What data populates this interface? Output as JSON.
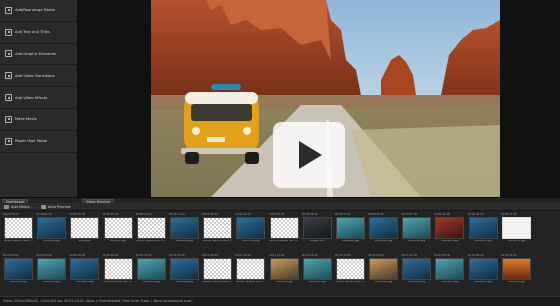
{
  "sidebar": {
    "items": [
      {
        "label": "Add/Rearrange Media",
        "icon": "media-icon"
      },
      {
        "label": "Add Text and Titles",
        "icon": "text-icon"
      },
      {
        "label": "Add Graphic Elements",
        "icon": "graphic-icon"
      },
      {
        "label": "Add Video Transitions",
        "icon": "transition-icon"
      },
      {
        "label": "Add Video Effects",
        "icon": "effects-icon"
      },
      {
        "label": "Make Movie",
        "icon": "movie-icon"
      },
      {
        "label": "Power User Mode",
        "icon": "power-user-icon"
      }
    ]
  },
  "tabs": {
    "left": "Dashboard",
    "right": "Video Preview"
  },
  "media_toolbar": {
    "add_media": "Add Media...",
    "auto_preview": "Auto Preview"
  },
  "gallery": {
    "rows": [
      [
        {
          "ts": "00:00:00.00",
          "name": "M0456 Yellow & Text Ti...",
          "kind": "text"
        },
        {
          "ts": "00:00:01.00",
          "name": "DSC09015.jpg",
          "kind": "blue"
        },
        {
          "ts": "00:00:05.00",
          "name": "unlog.text",
          "kind": "transparent"
        },
        {
          "ts": "00:00:07.00",
          "name": "launch01.jpg",
          "kind": "transparent"
        },
        {
          "ts": "00:00:10.00",
          "name": "M0456 Yellow & Text Ti...",
          "kind": "text"
        },
        {
          "ts": "00:00:14.00",
          "name": "DSC09024.jpg",
          "kind": "blue"
        },
        {
          "ts": "00:00:18.00",
          "name": "M0456 Yellow & Text Ti...",
          "kind": "text"
        },
        {
          "ts": "00:00:20.00",
          "name": "DSC07461.jpg",
          "kind": "blue"
        },
        {
          "ts": "00:00:25.00",
          "name": "M0456 Yellow & Text Ti...",
          "kind": "text"
        },
        {
          "ts": "00:00:28.00",
          "name": "unlog03.text",
          "kind": "dark"
        },
        {
          "ts": "00:00:30.00",
          "name": "DSC09061.jpg",
          "kind": "teal"
        },
        {
          "ts": "00:00:35.00",
          "name": "DSC09021.jpg",
          "kind": "blue"
        },
        {
          "ts": "00:00:37.00",
          "name": "DSC07481.jpg",
          "kind": "teal"
        },
        {
          "ts": "00:00:40.00",
          "name": "DSC09072.jpg",
          "kind": "red"
        },
        {
          "ts": "00:00:44.00",
          "name": "DSC09711.jpg",
          "kind": "blue"
        },
        {
          "ts": "00:00:47.00",
          "name": "DSC09711.jpg",
          "kind": "white"
        }
      ],
      [
        {
          "ts": "00:00:50.00",
          "name": "DSC09055.jpg",
          "kind": "blue"
        },
        {
          "ts": "00:00:53.00",
          "name": "DSC09123.jpg",
          "kind": "teal"
        },
        {
          "ts": "00:00:56.00",
          "name": "DSC09021.jpg",
          "kind": "blue"
        },
        {
          "ts": "00:00:59.00",
          "name": "M0456 Yellow & Text Ti...",
          "kind": "text"
        },
        {
          "ts": "00:01:01.00",
          "name": "DSC09082.jpg",
          "kind": "teal"
        },
        {
          "ts": "00:01:05.00",
          "name": "DSC09044.jpg",
          "kind": "blue"
        },
        {
          "ts": "00:01:08.00",
          "name": "M0456 Yellow & Text Ti...",
          "kind": "text"
        },
        {
          "ts": "00:01:10.00",
          "name": "M0456 Yellow & Text Ti...",
          "kind": "text"
        },
        {
          "ts": "00:01:12.00",
          "name": "DSC09213.jpg",
          "kind": "warm"
        },
        {
          "ts": "00:01:15.00",
          "name": "DSC09011.jpg",
          "kind": "teal"
        },
        {
          "ts": "00:01:18.00",
          "name": "M0456 Yellow & Text Ti...",
          "kind": "text"
        },
        {
          "ts": "00:01:20.00",
          "name": "DSC09041.jpg",
          "kind": "warm"
        },
        {
          "ts": "00:01:22.00",
          "name": "DSC09062.jpg",
          "kind": "blue"
        },
        {
          "ts": "00:01:25.00",
          "name": "DSC09051.jpg",
          "kind": "teal"
        },
        {
          "ts": "00:01:28.00",
          "name": "DSC09072.jpg",
          "kind": "blue"
        },
        {
          "ts": "00:01:32.00",
          "name": "DSC09213.jpg",
          "kind": "sunset"
        }
      ]
    ]
  },
  "status": {
    "text": "Video: 1920x1080x32, 1,000,000 fps, 00:01:23.00, Alpha = Premultiplied, Field Order Track = None (progressive scan)"
  }
}
